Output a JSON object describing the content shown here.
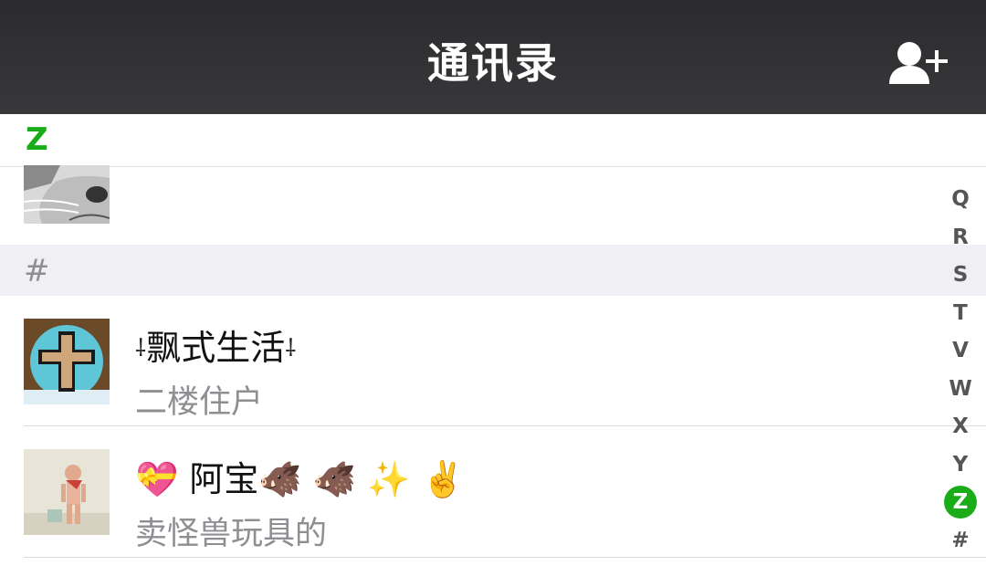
{
  "header": {
    "title": "通讯录"
  },
  "sticky_section": "Z",
  "hash_section": "#",
  "contacts": [
    {
      "name": "飘式生活",
      "subtitle": "二楼住户"
    },
    {
      "name": "💝 阿宝🐗 🐗 ✨ ✌️",
      "subtitle": "卖怪兽玩具的"
    }
  ],
  "decorations": {
    "left": "⸸",
    "right": "⸸"
  },
  "index_bar": [
    "Q",
    "R",
    "S",
    "T",
    "V",
    "W",
    "X",
    "Y",
    "Z",
    "#"
  ],
  "index_active": "Z",
  "colors": {
    "accent": "#1aad19",
    "nav_bg": "#2f2f31",
    "section_bg": "#efeff4"
  },
  "icons": {
    "add_contact": "add-user-icon"
  }
}
